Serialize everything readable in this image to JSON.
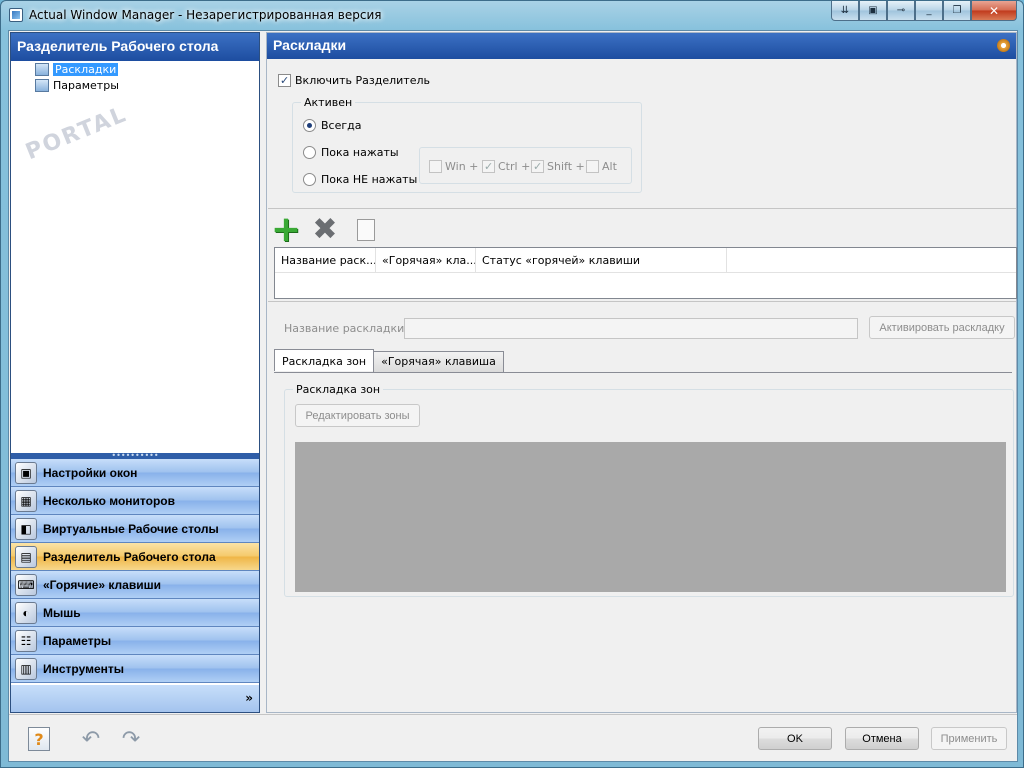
{
  "window": {
    "title": "Actual Window Manager - Незарегистрированная версия",
    "caption_buttons": [
      "⇊",
      "▣",
      "⊸",
      "_",
      "❐",
      "✕"
    ]
  },
  "left": {
    "header": "Разделитель Рабочего стола",
    "tree": [
      {
        "label": "Раскладки",
        "selected": true
      },
      {
        "label": "Параметры",
        "selected": false
      }
    ],
    "splitter": "••••••••••",
    "nav": [
      {
        "label": "Настройки окон",
        "icon": "window-settings-icon",
        "glyph": "▣",
        "active": false
      },
      {
        "label": "Несколько мониторов",
        "icon": "monitors-icon",
        "glyph": "▦",
        "active": false
      },
      {
        "label": "Виртуальные Рабочие столы",
        "icon": "virtual-desktops-icon",
        "glyph": "◧",
        "active": false
      },
      {
        "label": "Разделитель Рабочего стола",
        "icon": "desktop-divider-icon",
        "glyph": "▤",
        "active": true
      },
      {
        "label": "«Горячие» клавиши",
        "icon": "keyboard-icon",
        "glyph": "⌨",
        "active": false
      },
      {
        "label": "Мышь",
        "icon": "mouse-icon",
        "glyph": "◐",
        "active": false
      },
      {
        "label": "Параметры",
        "icon": "options-icon",
        "glyph": "☷",
        "active": false
      },
      {
        "label": "Инструменты",
        "icon": "tools-icon",
        "glyph": "▥",
        "active": false
      }
    ],
    "expand": "»"
  },
  "right": {
    "header": "Раскладки",
    "enable_label": "Включить Разделитель",
    "active_group": "Активен",
    "radios": [
      "Всегда",
      "Пока нажаты",
      "Пока НЕ нажаты"
    ],
    "hotkeys": [
      {
        "label": "Win +",
        "checked": false
      },
      {
        "label": "Ctrl +",
        "checked": true
      },
      {
        "label": "Shift +",
        "checked": true
      },
      {
        "label": "Alt",
        "checked": false
      }
    ],
    "grid_columns": [
      "Название раск...",
      "«Горячая» кла...",
      "Статус «горячей» клавиши"
    ],
    "name_label": "Название раскладки:",
    "name_value": "",
    "activate_button": "Активировать раскладку",
    "tabs": [
      "Раскладка зон",
      "«Горячая» клавиша"
    ],
    "zones_group": "Раскладка зон",
    "edit_zones_button": "Редактировать зоны"
  },
  "buttons": {
    "ok": "OK",
    "cancel": "Отмена",
    "apply": "Применить"
  },
  "colors": {
    "header_blue": "#1d4da0",
    "nav_active": "#f5c96a",
    "zone_preview": "#a9a9a9"
  }
}
